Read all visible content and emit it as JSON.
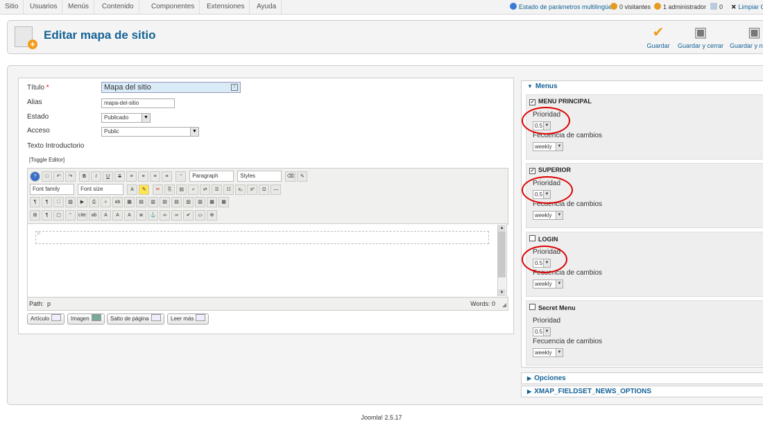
{
  "menu": {
    "items": [
      "Sitio",
      "Usuarios",
      "Menús",
      "Contenido",
      "Componentes",
      "Extensiones",
      "Ayuda"
    ]
  },
  "status": {
    "multilang": "Estado de parámetros multilingüe",
    "visitors": "0 visitantes",
    "admins": "1 administrador",
    "messages": "0",
    "clear": "Limpiar C"
  },
  "header": {
    "title": "Editar mapa de sitio",
    "buttons": {
      "save": "Guardar",
      "save_close": "Guardar y cerrar",
      "save_new": "Guardar y nu"
    }
  },
  "form": {
    "title_label": "Título",
    "title_value": "Mapa del sitio",
    "alias_label": "Alias",
    "alias_value": "mapa-del-sitio",
    "state_label": "Estado",
    "state_value": "Publicado",
    "access_label": "Acceso",
    "access_value": "Public",
    "intro_label": "Texto Introductorio",
    "toggle": "[Toggle Editor]"
  },
  "editor": {
    "font_family": "Font family",
    "font_size": "Font size",
    "format": "Paragraph",
    "styles": "Styles",
    "p_marker": "P",
    "path_label": "Path:",
    "path_value": "p",
    "words": "Words: 0"
  },
  "buttons": {
    "article": "Artículo",
    "image": "Imagen",
    "pagebreak": "Salto de página",
    "readmore": "Leer más"
  },
  "panel": {
    "menus_header": "Menus",
    "priority_label": "Prioridad",
    "freq_label": "Fecuencia de cambios",
    "items": [
      {
        "name": "MENU PRINCIPAL",
        "checked": true,
        "priority": "0.5",
        "freq": "weekly"
      },
      {
        "name": "SUPERIOR",
        "checked": true,
        "priority": "0.5",
        "freq": "weekly"
      },
      {
        "name": "LOGIN",
        "checked": false,
        "priority": "0.5",
        "freq": "weekly"
      },
      {
        "name": "Secret Menu",
        "checked": false,
        "priority": "0.5",
        "freq": "weekly"
      }
    ],
    "options": "Opciones",
    "news": "XMAP_FIELDSET_NEWS_OPTIONS"
  },
  "footer": "Joomla! 2.5.17",
  "colors": {
    "link": "#146295",
    "required": "#e00",
    "highlight": "#d00"
  }
}
